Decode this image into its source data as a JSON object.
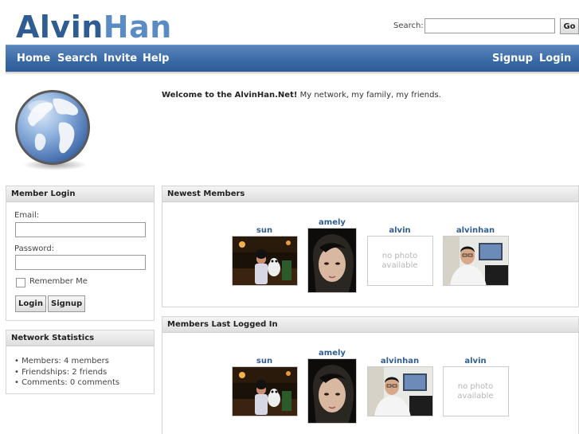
{
  "header": {
    "logo_part1": "Alvin",
    "logo_part2": "Han",
    "search_label": "Search:",
    "search_value": "",
    "go_label": "Go"
  },
  "nav": {
    "left": [
      "Home",
      "Search",
      "Invite",
      "Help"
    ],
    "right": [
      "Signup",
      "Login"
    ]
  },
  "welcome": {
    "bold": "Welcome to the AlvinHan.Net!",
    "text": " My network, my family, my friends."
  },
  "login": {
    "title": "Member Login",
    "email_label": "Email:",
    "email_value": "",
    "password_label": "Password:",
    "password_value": "",
    "remember_label": "Remember Me",
    "remember_checked": false,
    "login_button": "Login",
    "signup_button": "Signup"
  },
  "stats": {
    "title": "Network Statistics",
    "items": [
      "Members: 4 members",
      "Friendships: 2 friends",
      "Comments: 0 comments"
    ]
  },
  "newest_members": {
    "title": "Newest Members",
    "members": [
      {
        "name": "sun"
      },
      {
        "name": "amely"
      },
      {
        "name": "alvin",
        "no_photo": "no photo available"
      },
      {
        "name": "alvinhan"
      }
    ]
  },
  "last_logged": {
    "title": "Members Last Logged In",
    "members": [
      {
        "name": "sun"
      },
      {
        "name": "amely"
      },
      {
        "name": "alvinhan"
      },
      {
        "name": "alvin",
        "no_photo": "no photo available"
      }
    ]
  },
  "colors": {
    "brand_dark": "#2f5d93",
    "brand_light": "#5b8bc4",
    "nav_bar": "#3a6aa6"
  }
}
